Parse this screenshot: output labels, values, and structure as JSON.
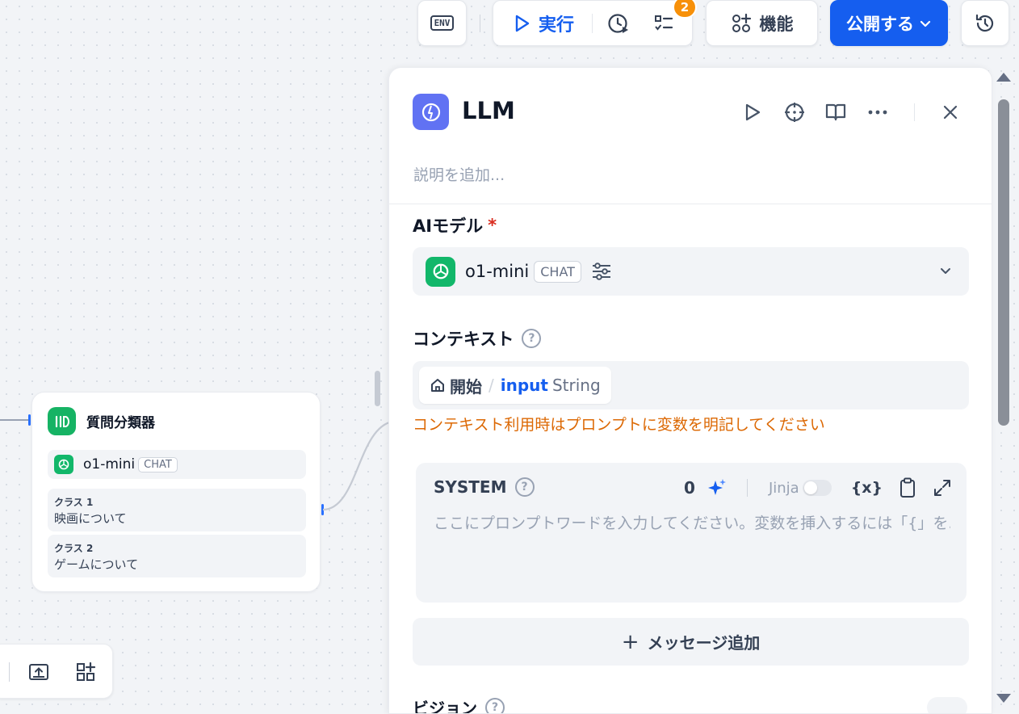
{
  "toolbar": {
    "env_label": "ENV",
    "run_label": "実行",
    "checklist_badge": "2",
    "features_label": "機能",
    "publish_label": "公開する"
  },
  "canvas": {
    "node": {
      "title": "質問分類器",
      "model_name": "o1-mini",
      "model_mode": "CHAT",
      "classes": [
        {
          "label": "クラス 1",
          "value": "映画について"
        },
        {
          "label": "クラス 2",
          "value": "ゲームについて"
        }
      ]
    }
  },
  "panel": {
    "title": "LLM",
    "description_placeholder": "説明を追加...",
    "model_section": {
      "label": "AIモデル",
      "required_mark": "*",
      "model_name": "o1-mini",
      "model_mode": "CHAT"
    },
    "context_section": {
      "label": "コンテキスト",
      "help": "?",
      "chip_node": "開始",
      "chip_separator": "/",
      "chip_variable": "input",
      "chip_type": "String",
      "warning": "コンテキスト利用時はプロンプトに変数を明記してください"
    },
    "system_prompt": {
      "role": "SYSTEM",
      "help": "?",
      "token_count": "0",
      "jinja_label": "Jinja",
      "variable_icon_text": "{x}",
      "placeholder": "ここにプロンプトワードを入力してください。変数を挿入するには「{」を..."
    },
    "add_message_label": "メッセージ追加",
    "vision": {
      "label": "ビジョン",
      "help": "?"
    }
  },
  "colors": {
    "accent": "#155eef",
    "warning": "#dc6803",
    "required": "#d92d20",
    "node_icon": "#16b364",
    "llm_icon": "#6172f3",
    "badge": "#f79009"
  }
}
